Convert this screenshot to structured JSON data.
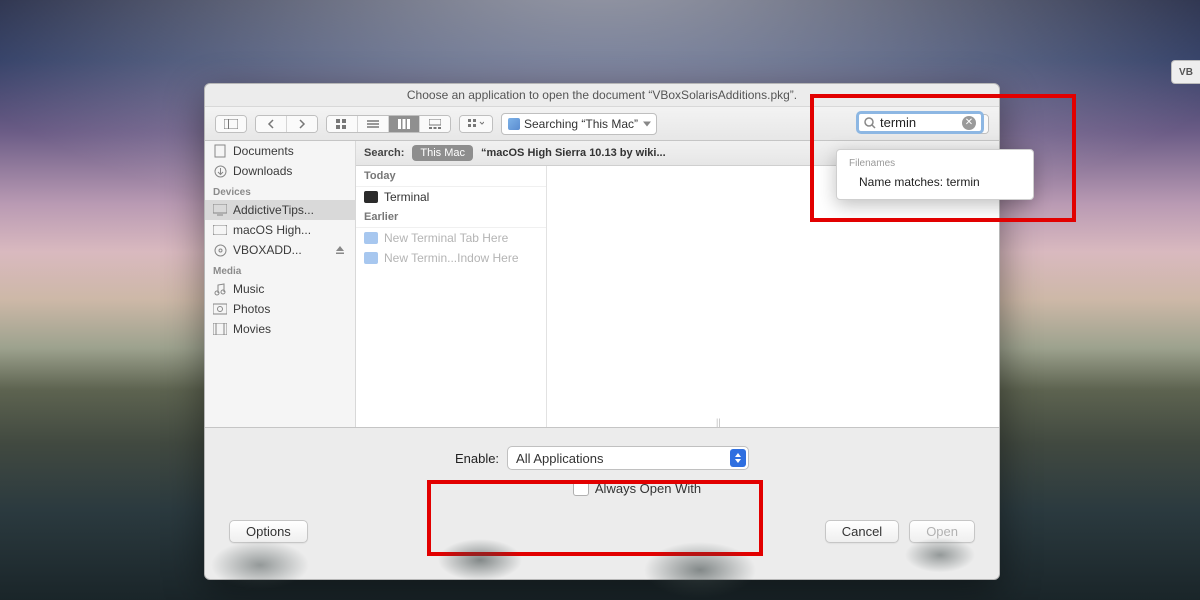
{
  "edge_tab": "VB",
  "dock_hint": "V",
  "title": "Choose an application to open the document “VBoxSolarisAdditions.pkg”.",
  "location_popup": "Searching “This Mac”",
  "search_query": "termin",
  "sidebar": {
    "favorites": [
      {
        "icon": "doc",
        "label": "Documents"
      },
      {
        "icon": "downloads",
        "label": "Downloads"
      }
    ],
    "devices_title": "Devices",
    "devices": [
      {
        "icon": "display",
        "label": "AddictiveTips...",
        "selected": true
      },
      {
        "icon": "hd",
        "label": "macOS High..."
      },
      {
        "icon": "disc",
        "label": "VBOXADD...",
        "eject": true
      }
    ],
    "media_title": "Media",
    "media": [
      {
        "icon": "music",
        "label": "Music"
      },
      {
        "icon": "photos",
        "label": "Photos"
      },
      {
        "icon": "movies",
        "label": "Movies"
      }
    ]
  },
  "searchbar": {
    "label": "Search:",
    "pill": "This Mac",
    "scope2": "“macOS High Sierra 10.13 by wiki..."
  },
  "list": {
    "g1": "Today",
    "i1": "Terminal",
    "g2": "Earlier",
    "i2": "New Terminal Tab Here",
    "i3": "New Termin...Indow Here"
  },
  "enable_label": "Enable:",
  "enable_value": "All Applications",
  "always_label": "Always Open With",
  "options_btn": "Options",
  "cancel_btn": "Cancel",
  "open_btn": "Open",
  "suggestions": {
    "hdr": "Filenames",
    "opt": "Name matches: termin"
  }
}
